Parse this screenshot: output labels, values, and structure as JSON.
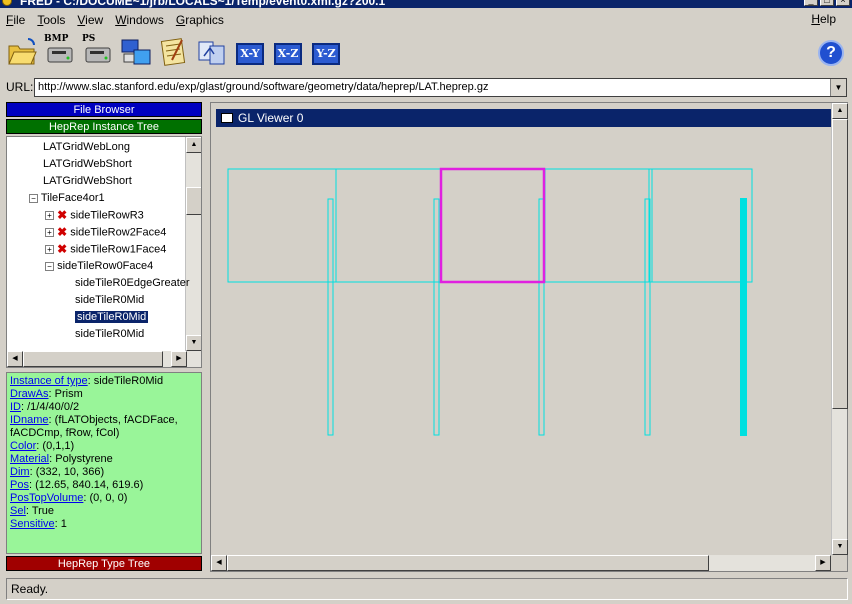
{
  "window": {
    "title": "FRED - C:/DOCUME~1/jrb/LOCALS~1/Temp/event0.xml.gz?200.1"
  },
  "menu": {
    "items": [
      "File",
      "Tools",
      "View",
      "Windows",
      "Graphics"
    ],
    "help": "Help"
  },
  "toolbar": {
    "bmp_label": "BMP",
    "ps_label": "PS",
    "xy": "X-Y",
    "xz": "X-Z",
    "yz": "Y-Z",
    "help_glyph": "?"
  },
  "url": {
    "label": "URL:",
    "value": "http://www.slac.stanford.edu/exp/glast/ground/software/geometry/data/heprep/LAT.heprep.gz"
  },
  "left": {
    "file_browser": "File Browser",
    "instance_tree": "HepRep Instance Tree",
    "type_tree": "HepRep Type Tree",
    "colors": {
      "file_browser": "#0000c0",
      "instance_tree": "#007000",
      "type_tree": "#a00000"
    }
  },
  "tree": {
    "rows": [
      {
        "label": "LATGridWebLong"
      },
      {
        "label": "LATGridWebShort"
      },
      {
        "label": "LATGridWebShort"
      },
      {
        "label": "TileFace4or1",
        "expander": "−"
      },
      {
        "label": "sideTileRowR3",
        "expander": "+",
        "error": true
      },
      {
        "label": "sideTileRow2Face4",
        "expander": "+",
        "error": true
      },
      {
        "label": "sideTileRow1Face4",
        "expander": "+",
        "error": true
      },
      {
        "label": "sideTileRow0Face4",
        "expander": "−"
      },
      {
        "label": "sideTileR0EdgeGreater"
      },
      {
        "label": "sideTileR0Mid"
      },
      {
        "label": "sideTileR0Mid",
        "selected": true
      },
      {
        "label": "sideTileR0Mid"
      }
    ]
  },
  "props": {
    "rows": [
      {
        "key": "Instance of type",
        "value": "sideTileR0Mid"
      },
      {
        "key": "DrawAs",
        "value": "Prism"
      },
      {
        "key": "ID",
        "value": "/1/4/40/0/2"
      },
      {
        "key": "IDname",
        "value": "(fLATObjects, fACDFace, fACDCmp, fRow, fCol)"
      },
      {
        "key": "Color",
        "value": "(0,1,1)"
      },
      {
        "key": "Material",
        "value": "Polystyrene"
      },
      {
        "key": "Dim",
        "value": "(332, 10, 366)"
      },
      {
        "key": "Pos",
        "value": "(12.65, 840.14, 619.6)"
      },
      {
        "key": "PosTopVolume",
        "value": "(0, 0, 0)"
      },
      {
        "key": "Sel",
        "value": "True"
      },
      {
        "key": "Sensitive",
        "value": "1"
      }
    ]
  },
  "viewer": {
    "title": "GL Viewer 0",
    "colors": {
      "geometry": "#00e0e0",
      "highlight": "#e020e0",
      "background": "#d4d0c8"
    }
  },
  "status": {
    "text": "Ready."
  }
}
